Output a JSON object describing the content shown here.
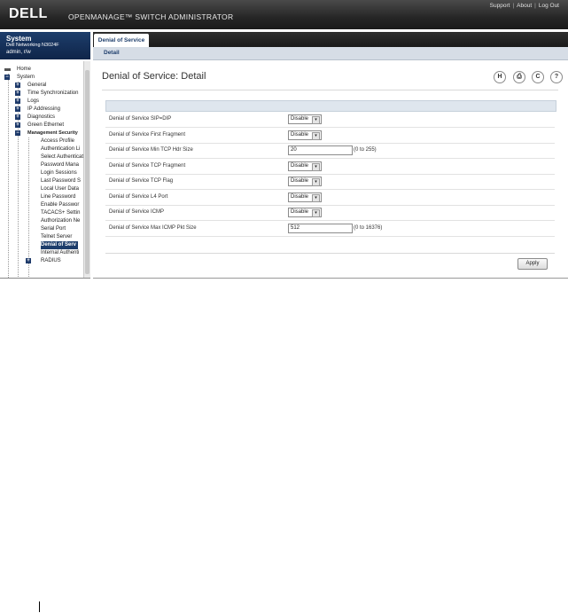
{
  "banner": {
    "logo": "DELL",
    "product": "OPENMANAGE™ SWITCH ADMINISTRATOR",
    "links": [
      "Support",
      "About",
      "Log Out"
    ]
  },
  "sidebar": {
    "title": "System",
    "model": "Dell Networking N3024F",
    "user": "admin, r/w",
    "tree": [
      {
        "label": "Home"
      },
      {
        "label": "System"
      },
      {
        "label": "General"
      },
      {
        "label": "Time Synchronization"
      },
      {
        "label": "Logs"
      },
      {
        "label": "IP Addressing"
      },
      {
        "label": "Diagnostics"
      },
      {
        "label": "Green Ethernet"
      },
      {
        "label": "Management Security"
      },
      {
        "label": "Access Profile"
      },
      {
        "label": "Authentication Li"
      },
      {
        "label": "Select Authenticat"
      },
      {
        "label": "Password Mana"
      },
      {
        "label": "Login Sessions"
      },
      {
        "label": "Last Password S"
      },
      {
        "label": "Local User Data"
      },
      {
        "label": "Line Password"
      },
      {
        "label": "Enable Passwor"
      },
      {
        "label": "TACACS+ Settin"
      },
      {
        "label": "Authorization Ne"
      },
      {
        "label": "Serial Port"
      },
      {
        "label": "Telnet Server"
      },
      {
        "label": "Denial of Serv"
      },
      {
        "label": "Internal Authenti"
      },
      {
        "label": "RADIUS"
      }
    ]
  },
  "tabs": {
    "main_tab": "Denial of Service",
    "sub_tab": "Detail"
  },
  "page": {
    "title": "Denial of Service: Detail",
    "icons": [
      "save-icon",
      "print-icon",
      "refresh-icon",
      "help-icon"
    ],
    "icon_glyphs": [
      "H",
      "⎙",
      "C",
      "?"
    ]
  },
  "form": {
    "rows": [
      {
        "label": "Denial of Service SIP=DIP",
        "type": "select",
        "value": "Disable"
      },
      {
        "label": "Denial of Service First Fragment",
        "type": "select",
        "value": "Disable"
      },
      {
        "label": "Denial of Service Min TCP Hdr Size",
        "type": "text",
        "value": "20",
        "range": "(0 to 255)"
      },
      {
        "label": "Denial of Service TCP Fragment",
        "type": "select",
        "value": "Disable"
      },
      {
        "label": "Denial of Service TCP Flag",
        "type": "select",
        "value": "Disable"
      },
      {
        "label": "Denial of Service L4 Port",
        "type": "select",
        "value": "Disable"
      },
      {
        "label": "Denial of Service ICMP",
        "type": "select",
        "value": "Disable"
      },
      {
        "label": "Denial of Service Max ICMP Pkt Size",
        "type": "text",
        "value": "512",
        "range": "(0 to 16376)"
      }
    ],
    "apply_label": "Apply"
  },
  "colors": {
    "banner": "#262626",
    "nav_blue": "#1d3d6b",
    "subbar": "#d6dde6"
  }
}
